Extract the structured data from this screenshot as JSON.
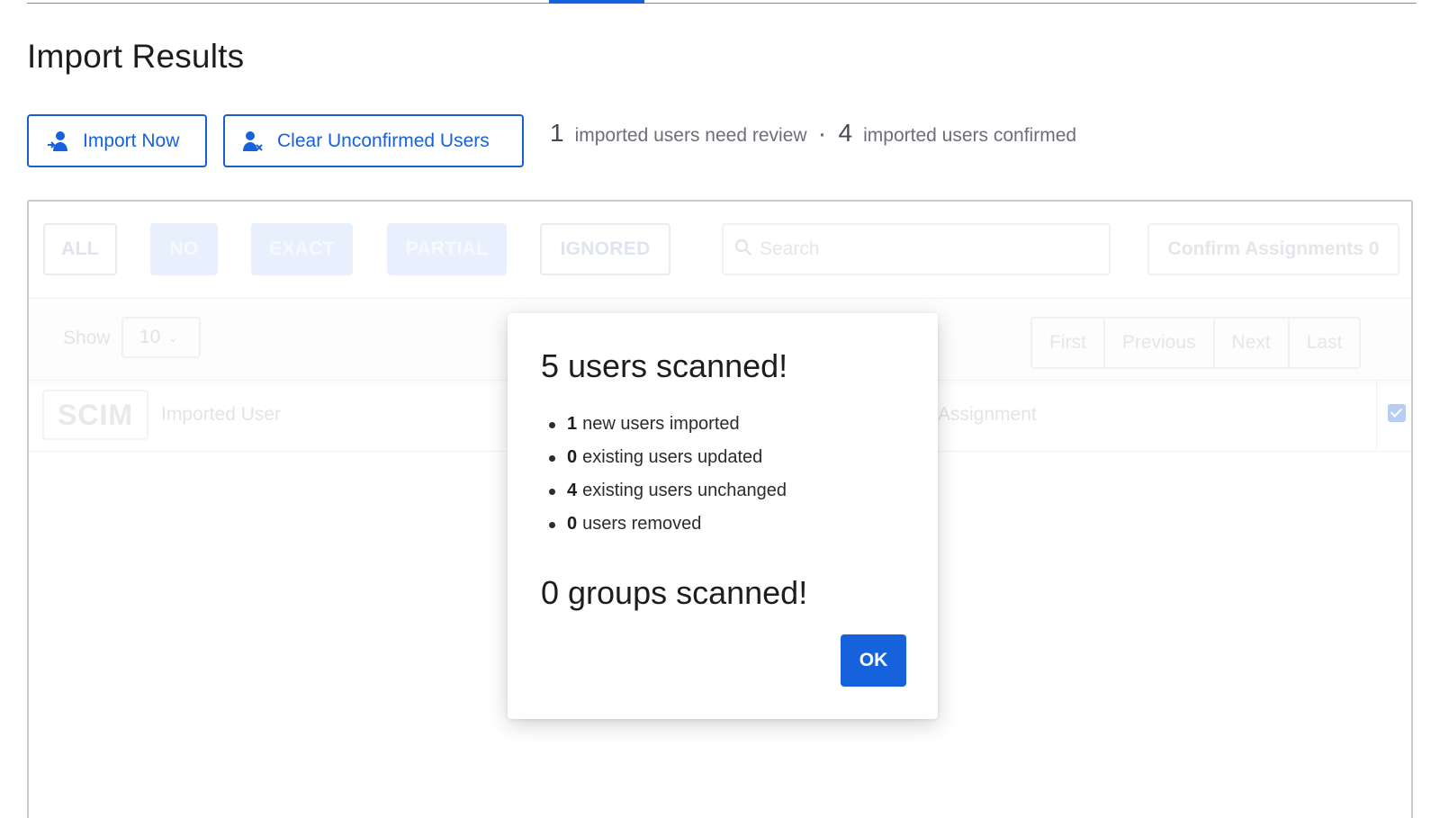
{
  "page": {
    "title": "Import Results"
  },
  "actions": {
    "import_now": "Import Now",
    "clear_unconfirmed": "Clear Unconfirmed Users"
  },
  "summary": {
    "review_count": "1",
    "review_text": "imported users need review",
    "separator": "·",
    "confirmed_count": "4",
    "confirmed_text": "imported users confirmed"
  },
  "filters": {
    "all": "ALL",
    "no": "NO",
    "exact": "EXACT",
    "partial": "PARTIAL",
    "ignored": "IGNORED"
  },
  "search": {
    "placeholder": "Search"
  },
  "confirm_assignments": "Confirm Assignments 0",
  "pagination": {
    "show_label": "Show",
    "page_size": "10",
    "first": "First",
    "previous": "Previous",
    "next": "Next",
    "last": "Last"
  },
  "table": {
    "logo_text": "SCIM",
    "columns": {
      "imported_user": "Imported User",
      "assignment": "Assignment"
    }
  },
  "modal": {
    "users_title": "5 users scanned!",
    "stats": [
      {
        "count": "1",
        "label": "new users imported"
      },
      {
        "count": "0",
        "label": "existing users updated"
      },
      {
        "count": "4",
        "label": "existing users unchanged"
      },
      {
        "count": "0",
        "label": "users removed"
      }
    ],
    "groups_title": "0 groups scanned!",
    "ok_label": "OK"
  },
  "colors": {
    "accent": "#1662dd",
    "text": "#1d1d21",
    "muted": "#6e6e78"
  }
}
